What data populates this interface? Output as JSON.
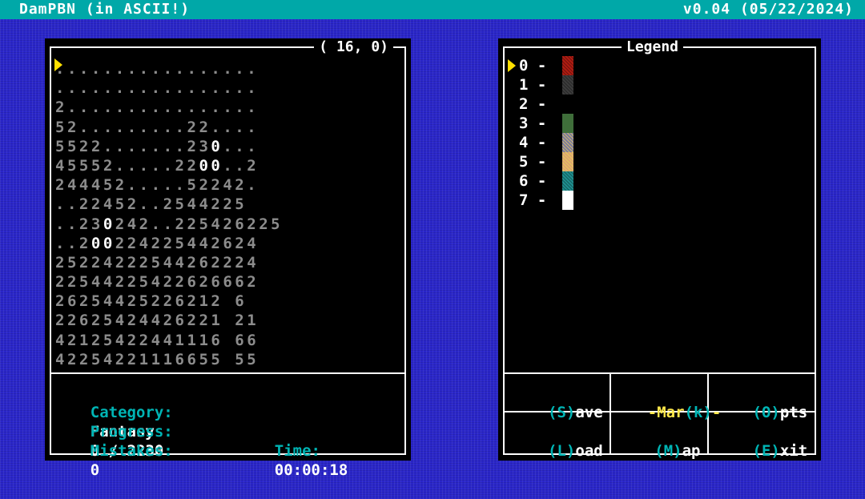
{
  "title_bar": {
    "app_title": "DamPBN (in ASCII!)",
    "version": "v0.04 (05/22/2024)"
  },
  "board": {
    "cursor_position": "( 16,  0)",
    "rows": [
      ".................",
      ".................",
      "2................",
      "52.........22....",
      "5522.......230...",
      "45552.....2200..2",
      "244452.....52242.",
      "..22452..2544225",
      "..230242..225426225",
      "..200224225442624",
      "25224222544262224",
      "22544225422626662",
      "26254425226212 6",
      "22625424426221 21",
      "42125422441116 66",
      "42254221116655 55"
    ],
    "colors": {
      "filled_digit": "#8c8c8c",
      "zero_digit": "#ffffff",
      "cursor": "#ffe000"
    }
  },
  "status": {
    "category_label": "Category:",
    "category_value": "Fantasy",
    "progress_label": "Progress:",
    "progress_value": "0 / 2230",
    "mistakes_label": "Mistakes:",
    "mistakes_value": "0",
    "time_label": "Time:",
    "time_value": "00:00:18"
  },
  "legend": {
    "title": "Legend",
    "selected_index": 0,
    "entries": [
      {
        "number": "0",
        "dash": "-",
        "color": "#b01c12",
        "pattern": "dither"
      },
      {
        "number": "1",
        "dash": "-",
        "color": "#3c3c3c",
        "pattern": "dither"
      },
      {
        "number": "2",
        "dash": "-",
        "color": "#000000",
        "pattern": "none"
      },
      {
        "number": "3",
        "dash": "-",
        "color": "#3f6e3a",
        "pattern": "solid"
      },
      {
        "number": "4",
        "dash": "-",
        "color": "#7a7a9e",
        "pattern": "dither-yellow"
      },
      {
        "number": "5",
        "dash": "-",
        "color": "#e0c060",
        "pattern": "dither-pink"
      },
      {
        "number": "6",
        "dash": "-",
        "color": "#1f8f8f",
        "pattern": "dither"
      },
      {
        "number": "7",
        "dash": "-",
        "color": "#ffffff",
        "pattern": "solid"
      }
    ]
  },
  "menu": {
    "save": {
      "hotkey": "(S)",
      "rest": "ave"
    },
    "mark": {
      "pre": "-Mar",
      "hotkey": "(k)",
      "post": "-"
    },
    "opts": {
      "hotkey": "(O)",
      "rest": "pts"
    },
    "load": {
      "hotkey": "(L)",
      "rest": "oad"
    },
    "map": {
      "hotkey": "(M)",
      "rest": "ap"
    },
    "exit": {
      "hotkey": "(E)",
      "rest": "xit"
    }
  }
}
